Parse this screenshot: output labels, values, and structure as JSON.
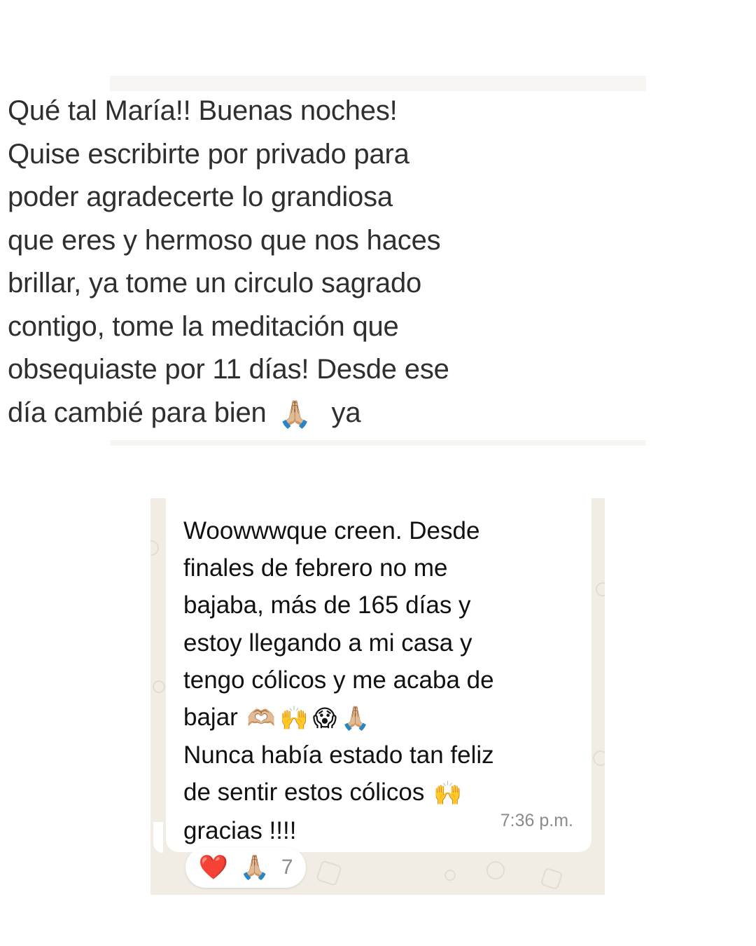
{
  "top_message": {
    "lines": [
      {
        "text": "Qué tal María!! Buenas noches!"
      },
      {
        "text": "Quise escribirte por privado para"
      },
      {
        "text": "poder agradecerte lo grandiosa"
      },
      {
        "text": "que eres y hermoso que nos haces"
      },
      {
        "text": "brillar, ya tome un circulo sagrado"
      },
      {
        "text": "contigo, tome la meditación que"
      },
      {
        "text": "obsequiaste por 11 días! Desde ese"
      },
      {
        "text": "día cambié para bien",
        "emoji": "🙏🏼",
        "after": "ya"
      }
    ]
  },
  "bottom_message": {
    "lines": [
      {
        "text": "Woowwwque creen. Desde"
      },
      {
        "text": "finales de febrero no me"
      },
      {
        "text": "bajaba, más de 165 días y"
      },
      {
        "text": "estoy llegando a mi casa y"
      },
      {
        "text": "tengo cólicos y me acaba de"
      },
      {
        "text": "bajar",
        "emojis": [
          "🫶🏼",
          "🙌",
          "😱",
          "🙏🏼"
        ]
      },
      {
        "text": "Nunca había estado tan feliz"
      },
      {
        "text": "de sentir estos cólicos",
        "emojis": [
          "🙌"
        ]
      },
      {
        "text": "gracias !!!!"
      }
    ],
    "timestamp": "7:36 p.m.",
    "reactions": {
      "heart": "❤️",
      "pray": "🙏🏼",
      "count": "7"
    }
  },
  "colors": {
    "bubble_bg": "#ffffff",
    "chat_bg": "#f1ede4",
    "text_top": "#2f2f2f",
    "text_bottom": "#111111",
    "timestamp": "#8a8a8a"
  }
}
